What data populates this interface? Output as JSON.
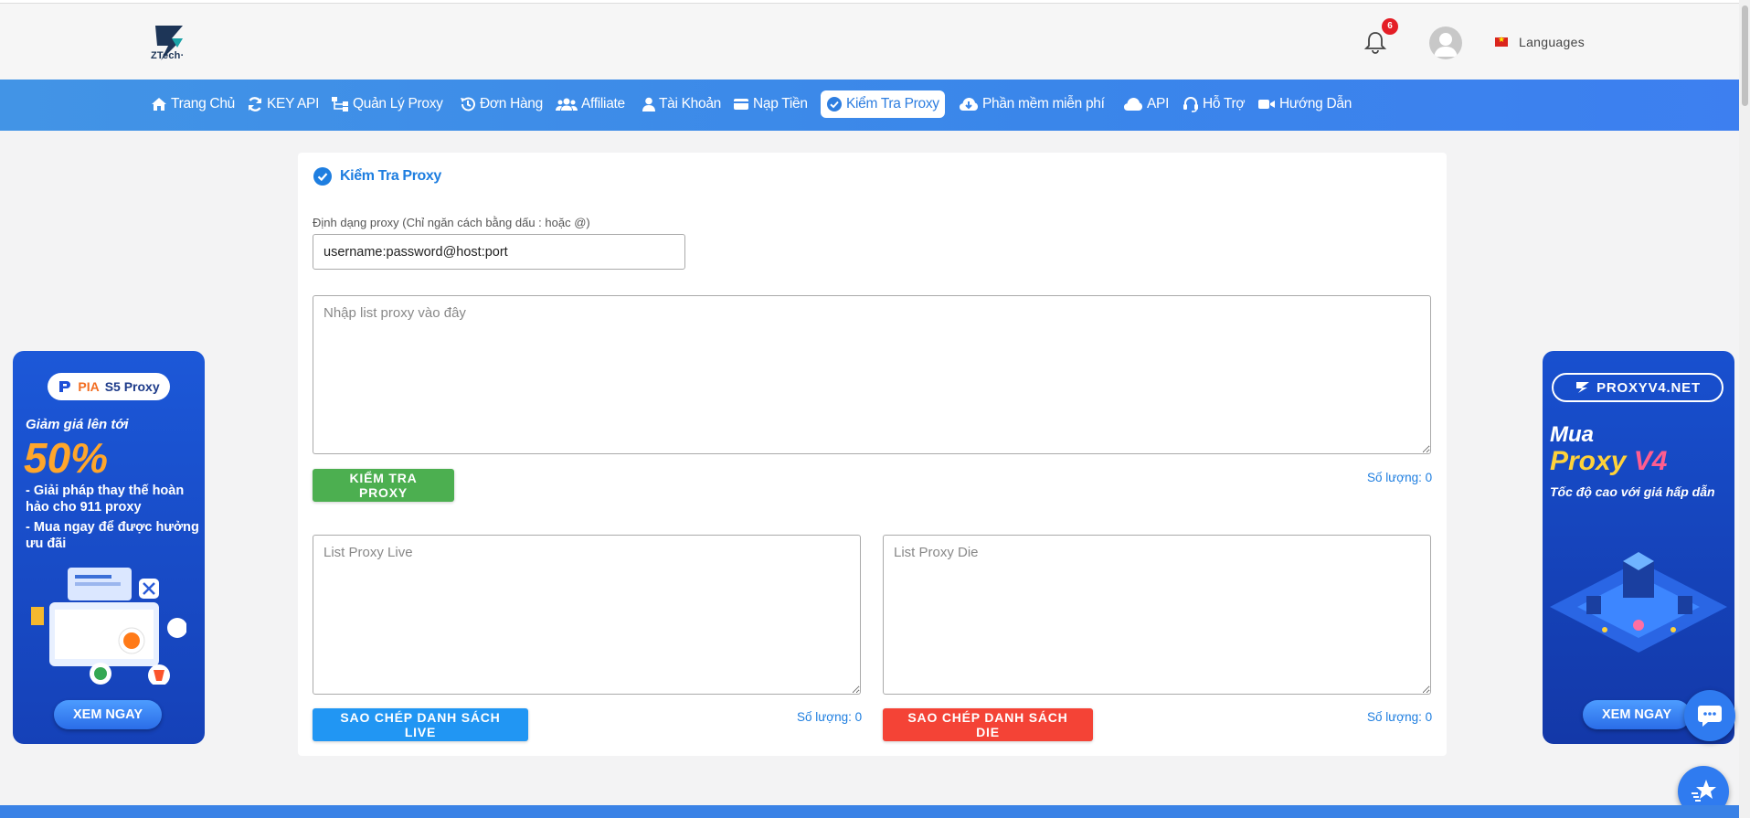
{
  "header": {
    "logo_text": "ZTech·",
    "notification_count": "6",
    "languages_label": "Languages"
  },
  "nav": {
    "items": [
      {
        "label": "Trang Chủ",
        "icon": "home-icon"
      },
      {
        "label": "KEY API",
        "icon": "refresh-icon"
      },
      {
        "label": "Quản Lý Proxy",
        "icon": "sitemap-icon"
      },
      {
        "label": "Đơn Hàng",
        "icon": "history-icon"
      },
      {
        "label": "Affiliate",
        "icon": "users-icon"
      },
      {
        "label": "Tài Khoản",
        "icon": "user-icon"
      },
      {
        "label": "Nạp Tiền",
        "icon": "wallet-icon"
      },
      {
        "label": "Kiểm Tra Proxy",
        "icon": "check-circle-icon",
        "active": true
      },
      {
        "label": "Phần mềm miễn phí",
        "icon": "cloud-download-icon"
      },
      {
        "label": "API",
        "icon": "cloud-icon"
      },
      {
        "label": "Hỗ Trợ",
        "icon": "headset-icon"
      },
      {
        "label": "Hướng Dẫn",
        "icon": "video-icon"
      }
    ]
  },
  "main": {
    "title": "Kiểm Tra Proxy",
    "format_label": "Định dạng proxy (Chỉ ngăn cách bằng dấu : hoặc @)",
    "format_value": "username:password@host:port",
    "list_placeholder": "Nhập list proxy vào đây",
    "check_button": "KIỂM TRA PROXY",
    "count_main": "Số lượng: 0",
    "live_placeholder": "List Proxy Live",
    "die_placeholder": "List Proxy Die",
    "copy_live_button": "SAO CHÉP DANH SÁCH LIVE",
    "copy_die_button": "SAO CHÉP DANH SÁCH DIE",
    "count_live": "Số lượng: 0",
    "count_die": "Số lượng: 0"
  },
  "ad_left": {
    "brand_pia": "PIA",
    "brand_rest": "S5 Proxy",
    "headline": "Giảm giá lên tới",
    "discount": "50%",
    "line1": "- Giải pháp thay thế hoàn hảo cho 911 proxy",
    "line2": "- Mua ngay để được hưởng ưu đãi",
    "cta": "XEM NGAY"
  },
  "ad_right": {
    "brand": "PROXYV4.NET",
    "mua": "Mua",
    "proxy_word": "Proxy",
    "v4_word": "V4",
    "subtitle": "Tốc độ cao với giá hấp dẫn",
    "cta": "XEM NGAY"
  },
  "colors": {
    "nav_bg": "#3a86ea",
    "accent": "#1e7ee0",
    "green": "#4caf50",
    "blue": "#2196f3",
    "red": "#f44336",
    "badge": "#e41e26"
  }
}
